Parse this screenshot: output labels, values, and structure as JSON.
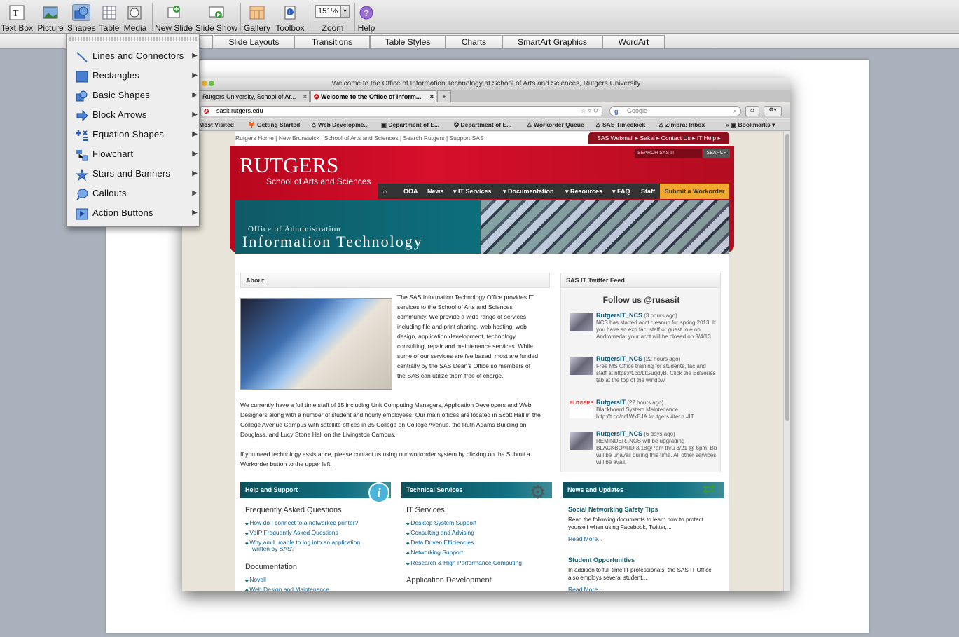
{
  "toolbar": {
    "items": [
      "Text Box",
      "Picture",
      "Shapes",
      "Table",
      "Media",
      "New Slide",
      "Slide Show",
      "Gallery",
      "Toolbox",
      "Zoom",
      "Help"
    ],
    "zoom_value": "151%"
  },
  "ribbon": {
    "tabs": [
      "Slide Layouts",
      "Transitions",
      "Table Styles",
      "Charts",
      "SmartArt Graphics",
      "WordArt"
    ]
  },
  "shapes_menu": {
    "items": [
      "Lines and Connectors",
      "Rectangles",
      "Basic Shapes",
      "Block Arrows",
      "Equation Shapes",
      "Flowchart",
      "Stars and Banners",
      "Callouts",
      "Action Buttons"
    ]
  },
  "browser": {
    "title": "Welcome to the Office of Information Technology at School of Arts and Sciences, Rutgers University",
    "tabs": [
      "Rutgers University, School of Ar...",
      "Welcome to the Office of Inform..."
    ],
    "url": "sasit.rutgers.edu",
    "search_placeholder": "Google",
    "bookmarks": [
      "Most Visited",
      "Getting Started",
      "Web Developme...",
      "Department of E...",
      "Department of E...",
      "Workorder Queue",
      "SAS Timeclock",
      "Zimbra: Inbox",
      "Bookmarks"
    ]
  },
  "site": {
    "breadcrumb": "Rutgers Home | New Brunswick | School of Arts and Sciences | Search Rutgers | Support SAS",
    "toplinks": "SAS Webmail ▸  Sakai ▸  Contact Us ▸  IT Help ▸",
    "logo": "RUTGERS",
    "logo_sub": "School of Arts and Sciences",
    "search_placeholder": "SEARCH SAS IT",
    "search_button": "SEARCH",
    "menu": [
      "OOA",
      "News",
      "▾ IT Services",
      "▾ Documentation",
      "▾ Resources",
      "▾ FAQ",
      "Staff",
      "Submit a Workorder"
    ],
    "banner_line1": "Office of Administration",
    "banner_line2": "Information Technology",
    "about_title": "About",
    "about_p1": "The SAS Information Technology Office provides IT services to the School of Arts and Sciences community. We provide a wide range of services including file and print sharing, web hosting, web design, application development, technology consulting, repair and maintenance services. While some of our services are fee based, most are funded centrally by the SAS Dean's Office so members of the SAS can utilize them free of charge.",
    "about_p2": "We currently have a full time staff of 15 including Unit Computing Managers, Application Developers and Web Designers along with a number of student and hourly employees. Our main offices are located in Scott Hall in the College Avenue Campus with satellite offices in 35 College on College Avenue, the Ruth Adams Building on Douglass, and Lucy Stone Hall on the Livingston Campus.",
    "about_p3": "If you need technology assistance, please contact us using our workorder system by clicking on the Submit a Workorder button to the upper left.",
    "twitter_title": "SAS IT Twitter Feed",
    "twitter_follow": "Follow us @rusasit",
    "tweets": [
      {
        "user": "RutgersIT_NCS",
        "age": "(3 hours ago)",
        "text": "NCS has started acct cleanup for spring 2013. If you have an exp fac, staff or guest role on Andromeda, your acct will be closed on 3/4/13"
      },
      {
        "user": "RutgersIT_NCS",
        "age": "(22 hours ago)",
        "text": "Free MS Office training for students, fac and staff at https://t.co/LtGuqdyB. Click the EdSeries tab at the top of the window."
      },
      {
        "user": "RutgersIT",
        "age": "(22 hours ago)",
        "text": "Blackboard System Maintenance http://t.co/nr1WxEJA #rutgers #tech #IT"
      },
      {
        "user": "RutgersIT_NCS",
        "age": "(6 days ago)",
        "text": "REMINDER..NCS will be upgrading BLACKBOARD 3/18@7am thru 3/21 @ 6pm. Bb will be unavail during this time. All other services will be avail."
      }
    ],
    "help": {
      "title": "Help and Support",
      "faq": "Frequently Asked Questions",
      "faq_links": [
        "How do I connect to a networked printer?",
        "VoIP Frequently Asked Questions",
        "Why am I unable to log into an application",
        "written by SAS?"
      ],
      "doc": "Documentation",
      "doc_links": [
        "Novell",
        "Web Design and Maintenance"
      ]
    },
    "tech": {
      "title": "Technical Services",
      "it": "IT Services",
      "it_links": [
        "Desktop System Support",
        "Consulting and Advising",
        "Data Driven Efficiencies",
        "Networking Support",
        "Research & High Performance Computing"
      ],
      "app": "Application Development"
    },
    "news": {
      "title": "News and Updates",
      "items": [
        {
          "t": "Social Networking Safety Tips",
          "d": "Read the following documents  to learn how to protect yourself when using Facebook, Twitter,...",
          "m": "Read More..."
        },
        {
          "t": "Student Opportunities",
          "d": "In addition to full time IT professionals, the SAS IT Office also employs several student...",
          "m": "Read More..."
        }
      ]
    }
  }
}
